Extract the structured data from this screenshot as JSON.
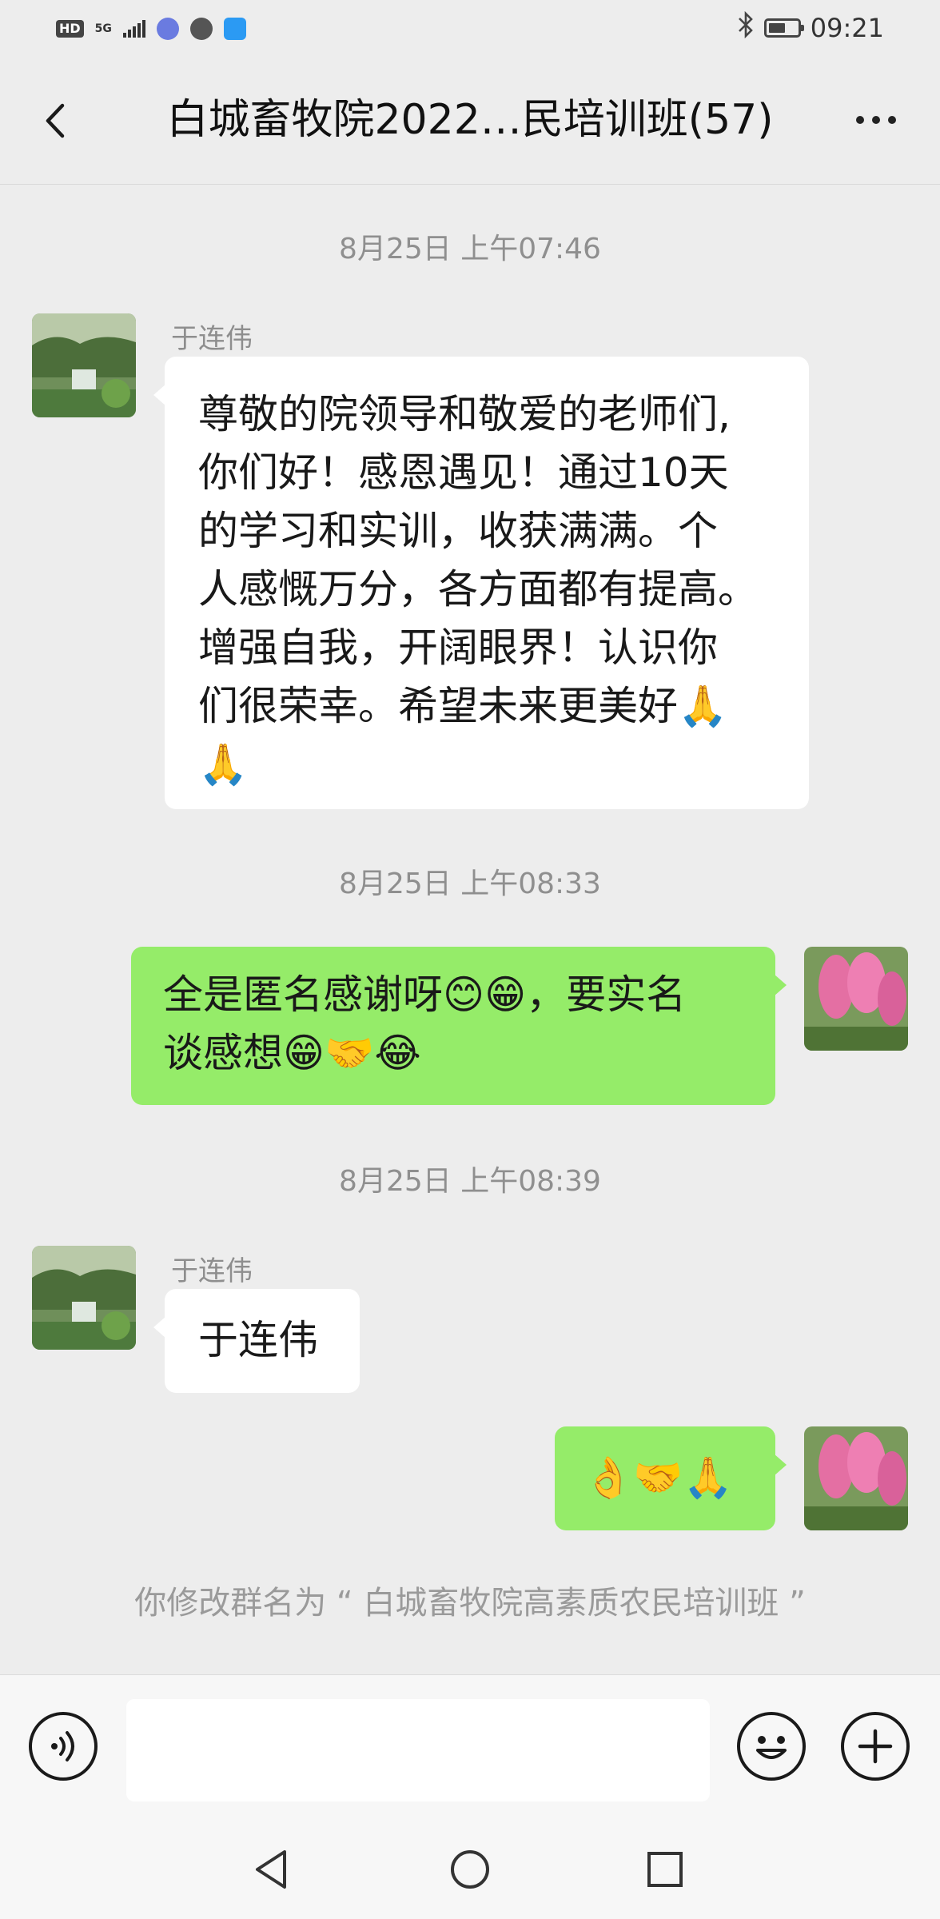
{
  "status_bar": {
    "hd": "HD",
    "network": "5G",
    "time": "09:21"
  },
  "header": {
    "title": "白城畜牧院2022…民培训班(57)",
    "back_icon": "chevron-left-icon",
    "more_icon": "more-dots-icon"
  },
  "messages": [
    {
      "type": "timestamp",
      "text": "8月25日 上午07:46"
    },
    {
      "type": "incoming",
      "sender": "于连伟",
      "lines": [
        "尊敬的院领导和敬爱的老师们,",
        "你们好！感恩遇见！通过10天",
        "的学习和实训，收获满满。个",
        "人感慨万分，各方面都有提高。",
        "增强自我，开阔眼界！认识你",
        "们很荣幸。希望未来更美好🙏",
        "🙏"
      ]
    },
    {
      "type": "timestamp",
      "text": "8月25日 上午08:33"
    },
    {
      "type": "outgoing",
      "lines": [
        "全是匿名感谢呀😊😁，要实名",
        "谈感想😁🤝😂"
      ]
    },
    {
      "type": "timestamp",
      "text": "8月25日 上午08:39"
    },
    {
      "type": "incoming",
      "sender": "于连伟",
      "lines": [
        "于连伟"
      ]
    },
    {
      "type": "outgoing",
      "lines": [
        "👌🤝🙏"
      ]
    },
    {
      "type": "system",
      "text": "你修改群名为 “ 白城畜牧院高素质农民培训班 ”"
    }
  ],
  "input_bar": {
    "voice_icon": "voice-icon",
    "input_value": "",
    "emoji_icon": "smiley-icon",
    "plus_icon": "plus-icon"
  },
  "nav_bar": {
    "back_icon": "triangle-back-icon",
    "home_icon": "circle-home-icon",
    "recents_icon": "square-recents-icon"
  },
  "colors": {
    "background": "#ededed",
    "outgoing_bubble": "#95ec69",
    "incoming_bubble": "#ffffff",
    "meta_text": "#8f8f8f"
  }
}
